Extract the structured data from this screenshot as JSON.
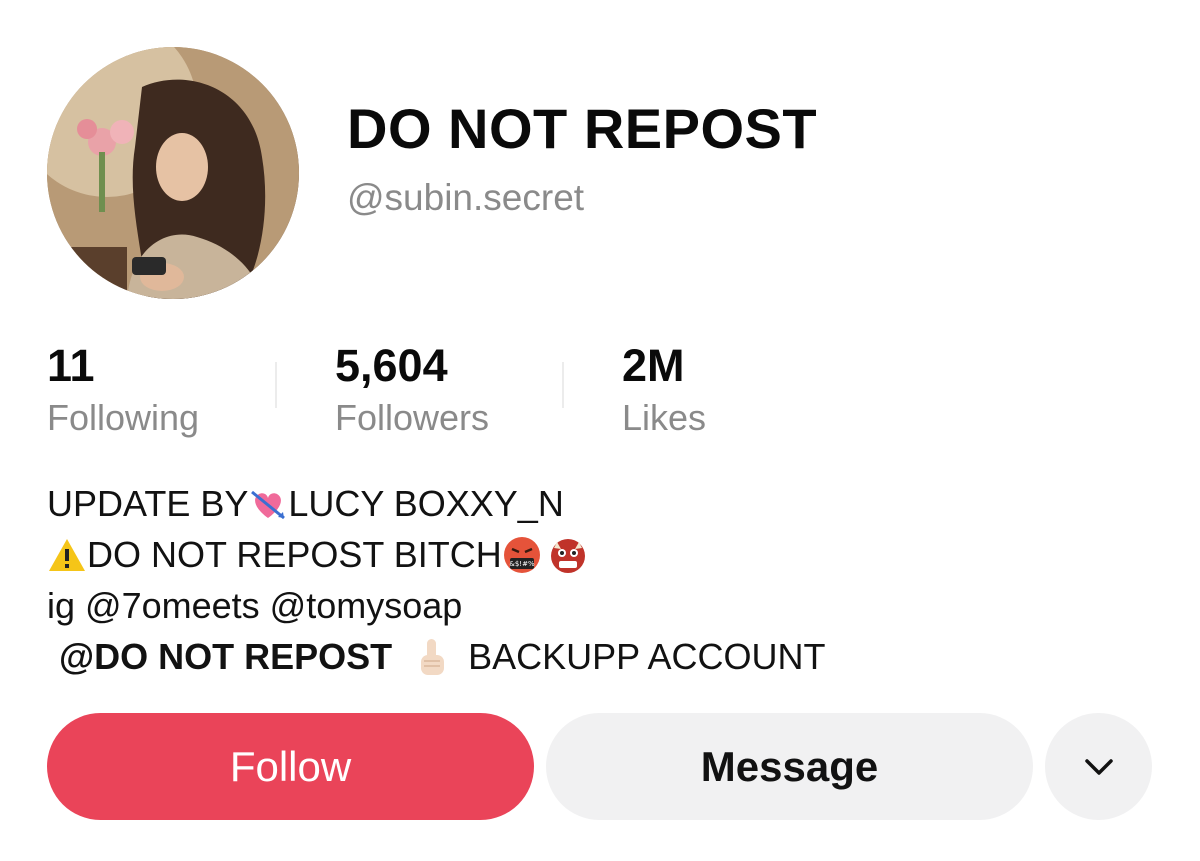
{
  "profile": {
    "display_name": "DO NOT REPOST",
    "handle": "@subin.secret",
    "avatar_alt": "profile photo"
  },
  "stats": [
    {
      "value": "11",
      "label": "Following"
    },
    {
      "value": "5,604",
      "label": "Followers"
    },
    {
      "value": "2M",
      "label": "Likes"
    }
  ],
  "bio": {
    "line1_a": "UPDATE BY",
    "line1_b": " LUCY BOXXY_N",
    "line2_a": "DO NOT REPOST BITCH ",
    "line3": "ig @7omeets @tomysoap",
    "line4_mention": "@DO NOT REPOST",
    "line4_rest": "BACKUPP ACCOUNT"
  },
  "actions": {
    "follow_label": "Follow",
    "message_label": "Message",
    "more_icon": "chevron-down-icon"
  },
  "colors": {
    "follow_bg": "#ea4459",
    "secondary_bg": "#f1f1f2",
    "muted_text": "#8a8a8a"
  }
}
